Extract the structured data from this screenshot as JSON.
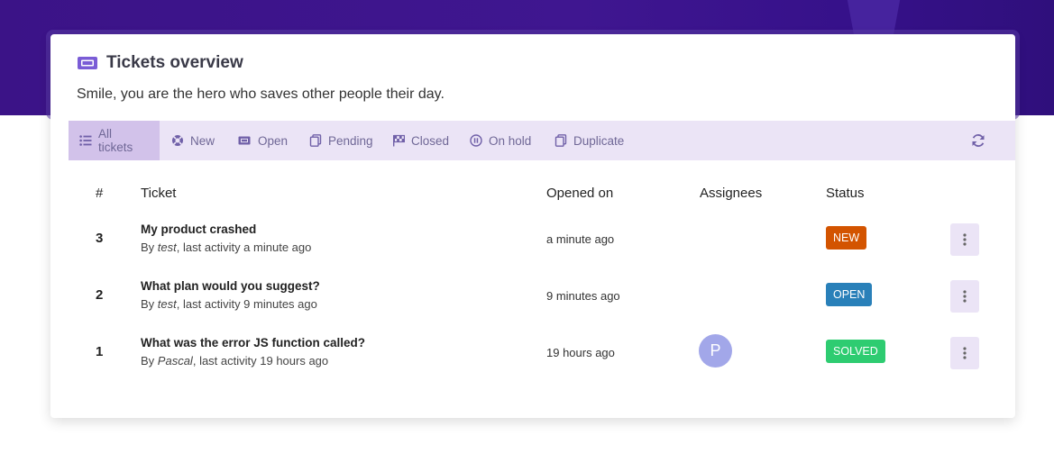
{
  "header": {
    "title": "Tickets overview",
    "subtitle": "Smile, you are the hero who saves other people their day."
  },
  "tabs": [
    {
      "label": "All tickets",
      "icon": "list-icon",
      "active": true
    },
    {
      "label": "New",
      "icon": "lifebuoy-icon",
      "active": false
    },
    {
      "label": "Open",
      "icon": "ticket-icon",
      "active": false
    },
    {
      "label": "Pending",
      "icon": "copy-icon",
      "active": false
    },
    {
      "label": "Closed",
      "icon": "flag-checkered-icon",
      "active": false
    },
    {
      "label": "On hold",
      "icon": "pause-circle-icon",
      "active": false
    },
    {
      "label": "Duplicate",
      "icon": "copy-icon",
      "active": false
    }
  ],
  "table": {
    "columns": [
      "#",
      "Ticket",
      "Opened on",
      "Assignees",
      "Status"
    ],
    "rows": [
      {
        "id": "3",
        "title": "My product crashed",
        "author": "test",
        "activity": "last activity a minute ago",
        "by": "By",
        "opened": "a minute ago",
        "assignee": "",
        "status": "NEW"
      },
      {
        "id": "2",
        "title": "What plan would you suggest?",
        "author": "test",
        "activity": "last activity 9 minutes ago",
        "by": "By",
        "opened": "9 minutes ago",
        "assignee": "",
        "status": "OPEN"
      },
      {
        "id": "1",
        "title": "What was the error JS function called?",
        "author": "Pascal",
        "activity": "last activity 19 hours ago",
        "by": "By",
        "opened": "19 hours ago",
        "assignee": "P",
        "status": "SOLVED"
      }
    ]
  },
  "colors": {
    "brand": "#3b1387",
    "toolbar": "#ebe4f6",
    "tab_active": "#d2c2ea",
    "accent_icon": "#7a5cd6",
    "status_new": "#d35400",
    "status_open": "#2980b9",
    "status_solved": "#2ecc71",
    "avatar": "#a2a7e9"
  }
}
